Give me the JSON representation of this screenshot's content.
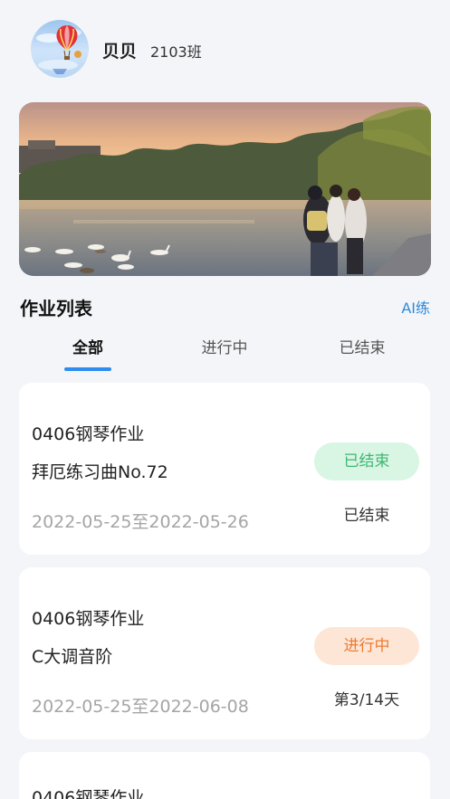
{
  "user": {
    "name": "贝贝",
    "class": "2103班"
  },
  "section": {
    "title": "作业列表",
    "ai_link": "AI练"
  },
  "tabs": [
    {
      "label": "全部",
      "active": true
    },
    {
      "label": "进行中",
      "active": false
    },
    {
      "label": "已结束",
      "active": false
    }
  ],
  "assignments": [
    {
      "title": "0406钢琴作业",
      "piece": "拜厄练习曲No.72",
      "date_range": "2022-05-25至2022-05-26",
      "badge": "已结束",
      "status": "已结束"
    },
    {
      "title": "0406钢琴作业",
      "piece": "C大调音阶",
      "date_range": "2022-05-25至2022-06-08",
      "badge": "进行中",
      "status": "第3/14天"
    },
    {
      "title": "0406钢琴作业"
    }
  ],
  "colors": {
    "accent": "#2d8cf0",
    "ended_bg": "#d9f5e3",
    "ended_text": "#3eb874",
    "ongoing_bg": "#fde6d6",
    "ongoing_text": "#ee7a33"
  },
  "icons": {
    "avatar": "hot-air-balloon-avatar",
    "banner": "lake-with-geese-photo"
  }
}
